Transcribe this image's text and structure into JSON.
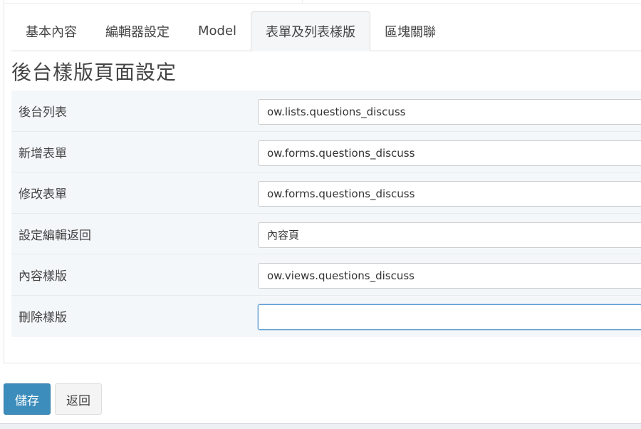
{
  "tabs": [
    {
      "label": "基本內容",
      "active": false
    },
    {
      "label": "編輯器設定",
      "active": false
    },
    {
      "label": "Model",
      "active": false
    },
    {
      "label": "表單及列表樣版",
      "active": true
    },
    {
      "label": "區塊關聯",
      "active": false
    }
  ],
  "page_title": "後台樣版頁面設定",
  "fields": [
    {
      "label": "後台列表",
      "value": "ow.lists.questions_discuss"
    },
    {
      "label": "新增表單",
      "value": "ow.forms.questions_discuss"
    },
    {
      "label": "修改表單",
      "value": "ow.forms.questions_discuss"
    },
    {
      "label": "設定編輯返回",
      "value": "內容頁"
    },
    {
      "label": "內容樣版",
      "value": "ow.views.questions_discuss"
    },
    {
      "label": "刪除樣版",
      "value": ""
    }
  ],
  "buttons": {
    "save_label": "儲存",
    "back_label": "返回"
  },
  "colors": {
    "primary": "#3c8dbc",
    "row_bg": "#f4f7fa",
    "focus_border": "#5b9bd1"
  }
}
